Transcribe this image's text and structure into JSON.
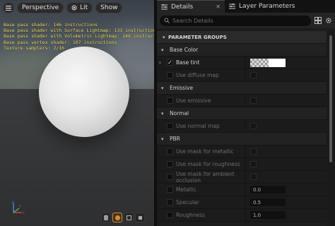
{
  "viewport": {
    "toolbar": {
      "perspective_label": "Perspective",
      "lit_label": "Lit",
      "show_label": "Show"
    },
    "stats": [
      "Base pass shader: 146 instructions",
      "Base pass shader with Surface Lightmap: 133 instructions",
      "Base pass shader with Volumetric Lightmap: 146 instructions",
      "Base pass vertex shader: 107 instructions",
      "Texture samplers: 2/16"
    ],
    "preview_shapes": [
      "cylinder-icon",
      "sphere-icon",
      "plane-icon",
      "cube-icon"
    ],
    "selected_shape": "sphere-icon",
    "colors": {
      "stats_text": "#f5e16a",
      "selected_accent": "#d88a2a"
    }
  },
  "tabs": [
    {
      "label": "Details",
      "active": true
    },
    {
      "label": "Layer Parameters",
      "active": false
    }
  ],
  "search": {
    "placeholder": "Search Details"
  },
  "details": {
    "group_header": "PARAMETER GROUPS",
    "categories": {
      "base_color": "Base Color",
      "emissive": "Emissive",
      "normal": "Normal",
      "pbr": "PBR"
    },
    "rows": {
      "base_tint": {
        "label": "Base tint",
        "checked": true
      },
      "use_diffuse_map": {
        "label": "Use diffuse map"
      },
      "use_emissive": {
        "label": "Use emissive"
      },
      "use_normal_map": {
        "label": "Use normal map"
      },
      "use_mask_metallic": {
        "label": "Use mask for metallic"
      },
      "use_mask_roughness": {
        "label": "Use mask for roughness"
      },
      "use_mask_ao": {
        "label": "Use mask for ambient occlusion"
      },
      "metallic": {
        "label": "Metallic",
        "value": "0.0"
      },
      "specular": {
        "label": "Specular",
        "value": "0.5"
      },
      "roughness": {
        "label": "Roughness",
        "value": "1.0"
      }
    }
  }
}
